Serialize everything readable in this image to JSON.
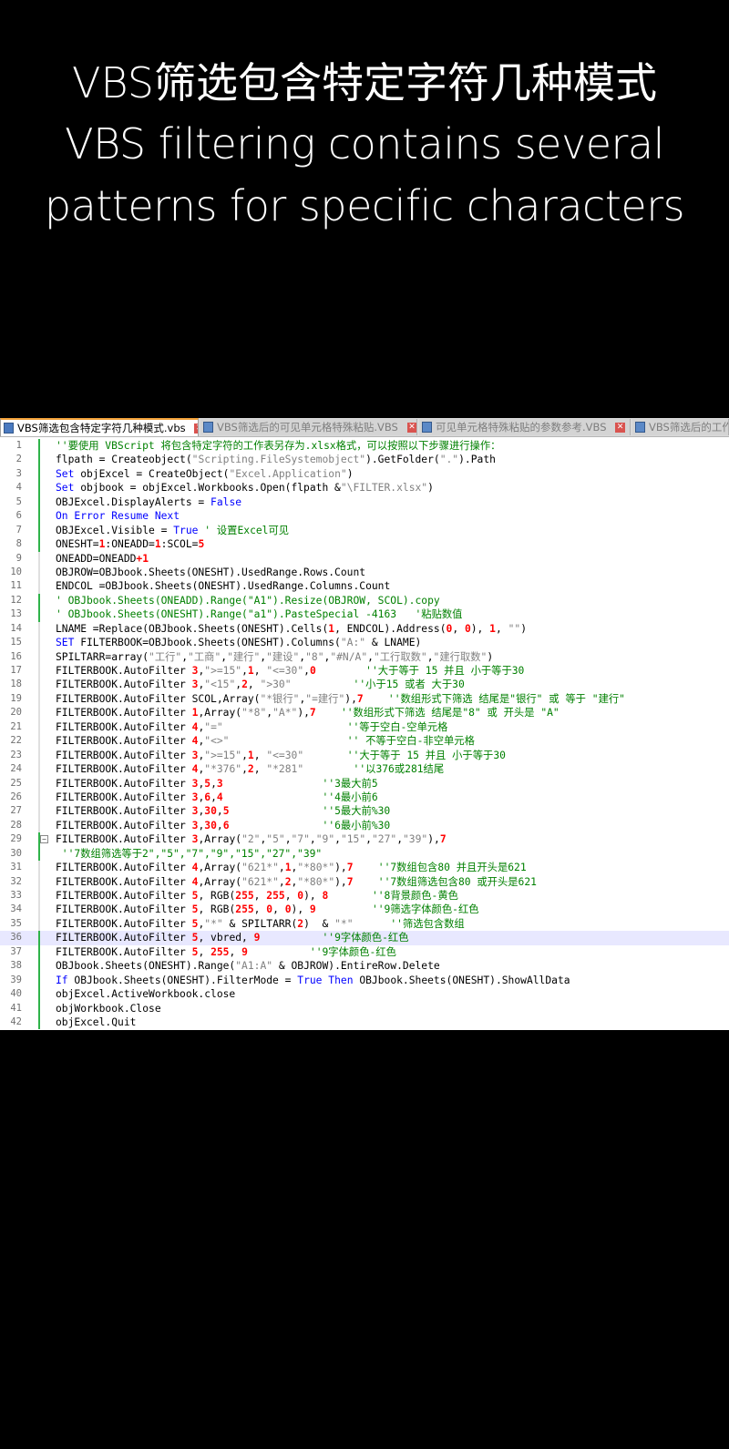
{
  "title": {
    "line1": "VBS筛选包含特定字符几种模式",
    "line2": "VBS filtering contains several",
    "line3": "patterns for specific characters"
  },
  "tabs": [
    {
      "label": "VBS筛选包含特定字符几种模式.vbs",
      "active": true
    },
    {
      "label": "VBS筛选后的可见单元格特殊粘贴.VBS",
      "active": false
    },
    {
      "label": "可见单元格特殊粘贴的参数参考.VBS",
      "active": false
    },
    {
      "label": "VBS筛选后的工作",
      "active": false
    }
  ],
  "line_numbers": [
    "1",
    "2",
    "3",
    "4",
    "5",
    "6",
    "7",
    "8",
    "9",
    "10",
    "11",
    "12",
    "13",
    "14",
    "15",
    "16",
    "17",
    "18",
    "19",
    "20",
    "21",
    "22",
    "23",
    "24",
    "25",
    "26",
    "27",
    "28",
    "29",
    "30",
    "31",
    "32",
    "33",
    "34",
    "35",
    "36",
    "37",
    "38",
    "39",
    "40",
    "41",
    "42"
  ],
  "code": {
    "l1": [
      "''要使用 VBScript 将包含特定字符的工作表另存为.xlsx格式，可以按照以下步骤进行操作："
    ],
    "l2": [
      "flpath = Createobject(",
      "\"Scripting.FileSystemobject\"",
      ").GetFolder(",
      "\".\"",
      ").Path"
    ],
    "l3": [
      "Set",
      " objExcel = CreateObject(",
      "\"Excel.Application\"",
      ")"
    ],
    "l4": [
      "Set",
      " objbook = objExcel.Workbooks.Open(flpath &",
      "\"\\FILTER.xlsx\"",
      ")"
    ],
    "l5": [
      "OBJExcel.DisplayAlerts = ",
      "False"
    ],
    "l6": [
      "On Error Resume Next"
    ],
    "l7": [
      "OBJExcel.Visible = ",
      "True",
      " ",
      "' 设置Excel可见"
    ],
    "l8": [
      "ONESHT=",
      "1",
      ":ONEADD=",
      "1",
      ":SCOL=",
      "5"
    ],
    "l9": [
      "ONEADD=ONEADD",
      "+1"
    ],
    "l10": [
      "OBJROW=OBJbook.Sheets(ONESHT).UsedRange.Rows.Count"
    ],
    "l11": [
      "ENDCOL =OBJbook.Sheets(ONESHT).UsedRange.Columns.Count"
    ],
    "l12": [
      "' OBJbook.Sheets(ONEADD).Range(\"A1\").Resize(OBJROW, SCOL).copy"
    ],
    "l13": [
      "' OBJbook.Sheets(ONESHT).Range(\"a1\").PasteSpecial -4163   '粘贴数值"
    ],
    "l14": [
      "LNAME =Replace(OBJbook.Sheets(ONESHT).Cells(",
      "1",
      ", ENDCOL).Address(",
      "0",
      ", ",
      "0",
      "), ",
      "1",
      ", ",
      "\"\"",
      ")"
    ],
    "l15": [
      "SET",
      " FILTERBOOK=OBJbook.Sheets(ONESHT).Columns(",
      "\"A:\"",
      " & LNAME)"
    ],
    "l16": [
      "SPILTARR=array(",
      "\"工行\"",
      ",",
      "\"工商\"",
      ",",
      "\"建行\"",
      ",",
      "\"建设\"",
      ",",
      "\"8\"",
      ",",
      "\"#N/A\"",
      ",",
      "\"工行取数\"",
      ",",
      "\"建行取数\"",
      ")"
    ],
    "l17": [
      "FILTERBOOK.AutoFilter ",
      "3",
      ",",
      "\">=15\"",
      ",",
      "1",
      ", ",
      "\"<=30\"",
      ",",
      "0",
      "        ",
      "''大于等于 15 并且 小于等于30"
    ],
    "l18": [
      "FILTERBOOK.AutoFilter ",
      "3",
      ",",
      "\"<15\"",
      ",",
      "2",
      ", ",
      "\">30\"",
      "          ",
      "''小于15 或者 大于30"
    ],
    "l19": [
      "FILTERBOOK.AutoFilter SCOL,Array(",
      "\"*银行\"",
      ",",
      "\"=建行\"",
      "),",
      "7",
      "    ",
      "''数组形式下筛选 结尾是\"银行\" 或 等于 \"建行\""
    ],
    "l20": [
      "FILTERBOOK.AutoFilter ",
      "1",
      ",Array(",
      "\"*8\"",
      ",",
      "\"A*\"",
      "),",
      "7",
      "    ",
      "''数组形式下筛选 结尾是\"8\" 或 开头是 \"A\""
    ],
    "l21": [
      "FILTERBOOK.AutoFilter ",
      "4",
      ",",
      "\"=\"",
      "                    ",
      "''等于空白-空单元格"
    ],
    "l22": [
      "FILTERBOOK.AutoFilter ",
      "4",
      ",",
      "\"<>\"",
      "                   ",
      "'' 不等于空白-非空单元格"
    ],
    "l23": [
      "FILTERBOOK.AutoFilter ",
      "3",
      ",",
      "\">=15\"",
      ",",
      "1",
      ", ",
      "\"<=30\"",
      "       ",
      "''大于等于 15 并且 小于等于30"
    ],
    "l24": [
      "FILTERBOOK.AutoFilter ",
      "4",
      ",",
      "\"*376\"",
      ",",
      "2",
      ", ",
      "\"*281\"",
      "        ",
      "''以376或281结尾"
    ],
    "l25": [
      "FILTERBOOK.AutoFilter ",
      "3",
      ",",
      "5",
      ",",
      "3",
      "                ",
      "''3最大前5"
    ],
    "l26": [
      "FILTERBOOK.AutoFilter ",
      "3",
      ",",
      "6",
      ",",
      "4",
      "                ",
      "''4最小前6"
    ],
    "l27": [
      "FILTERBOOK.AutoFilter ",
      "3",
      ",",
      "30",
      ",",
      "5",
      "               ",
      "''5最大前%30"
    ],
    "l28": [
      "FILTERBOOK.AutoFilter ",
      "3",
      ",",
      "30",
      ",",
      "6",
      "               ",
      "''6最小前%30"
    ],
    "l29": [
      "FILTERBOOK.AutoFilter ",
      "3",
      ",Array(",
      "\"2\"",
      ",",
      "\"5\"",
      ",",
      "\"7\"",
      ",",
      "\"9\"",
      ",",
      "\"15\"",
      ",",
      "\"27\"",
      ",",
      "\"39\"",
      "),",
      "7"
    ],
    "l30": [
      " ''7数组筛选等于2\",\"5\",\"7\",\"9\",\"15\",\"27\",\"39\""
    ],
    "l31": [
      "FILTERBOOK.AutoFilter ",
      "4",
      ",Array(",
      "\"621*\"",
      ",",
      "1",
      ",",
      "\"*80*\"",
      "),",
      "7",
      "    ",
      "''7数组包含80 并且开头是621"
    ],
    "l32": [
      "FILTERBOOK.AutoFilter ",
      "4",
      ",Array(",
      "\"621*\"",
      ",",
      "2",
      ",",
      "\"*80*\"",
      "),",
      "7",
      "    ",
      "''7数组筛选包含80 或开头是621"
    ],
    "l33": [
      "FILTERBOOK.AutoFilter ",
      "5",
      ", RGB(",
      "255",
      ", ",
      "255",
      ", ",
      "0",
      "), ",
      "8",
      "       ",
      "''8背景颜色-黄色"
    ],
    "l34": [
      "FILTERBOOK.AutoFilter ",
      "5",
      ", RGB(",
      "255",
      ", ",
      "0",
      ", ",
      "0",
      "), ",
      "9",
      "         ",
      "''9筛选字体颜色-红色"
    ],
    "l35": [
      "FILTERBOOK.AutoFilter ",
      "5",
      ",",
      "\"*\"",
      " & SPILTARR(",
      "2",
      ")  & ",
      "\"*\"",
      "      ",
      "''筛选包含数组"
    ],
    "l36": [
      "FILTERBOOK.AutoFilter ",
      "5",
      ", vbred, ",
      "9",
      "          ",
      "''9字体颜色-红色"
    ],
    "l37": [
      "FILTERBOOK.AutoFilter ",
      "5",
      ", ",
      "255",
      ", ",
      "9",
      "          ",
      "''9字体颜色-红色"
    ],
    "l38": [
      "OBJbook.Sheets(ONESHT).Range(",
      "\"A1:A\"",
      " & OBJROW).EntireRow.Delete"
    ],
    "l39": [
      "If",
      " OBJbook.Sheets(ONESHT).FilterMode = ",
      "True",
      " ",
      "Then",
      " OBJbook.Sheets(ONESHT).ShowAllData"
    ],
    "l40": [
      "objExcel.ActiveWorkbook.close"
    ],
    "l41": [
      "objWorkbook.Close"
    ],
    "l42": [
      "objExcel.Quit"
    ]
  },
  "icons": {
    "tab_file": "file-icon",
    "tab_close": "close-icon",
    "fold": "fold-minus-icon"
  },
  "colors": {
    "keyword": "#0000ff",
    "string": "#808080",
    "comment": "#008000",
    "number": "#ff0000",
    "active_tab_accent": "#f3a23a",
    "change_bar": "#2fb34a"
  }
}
